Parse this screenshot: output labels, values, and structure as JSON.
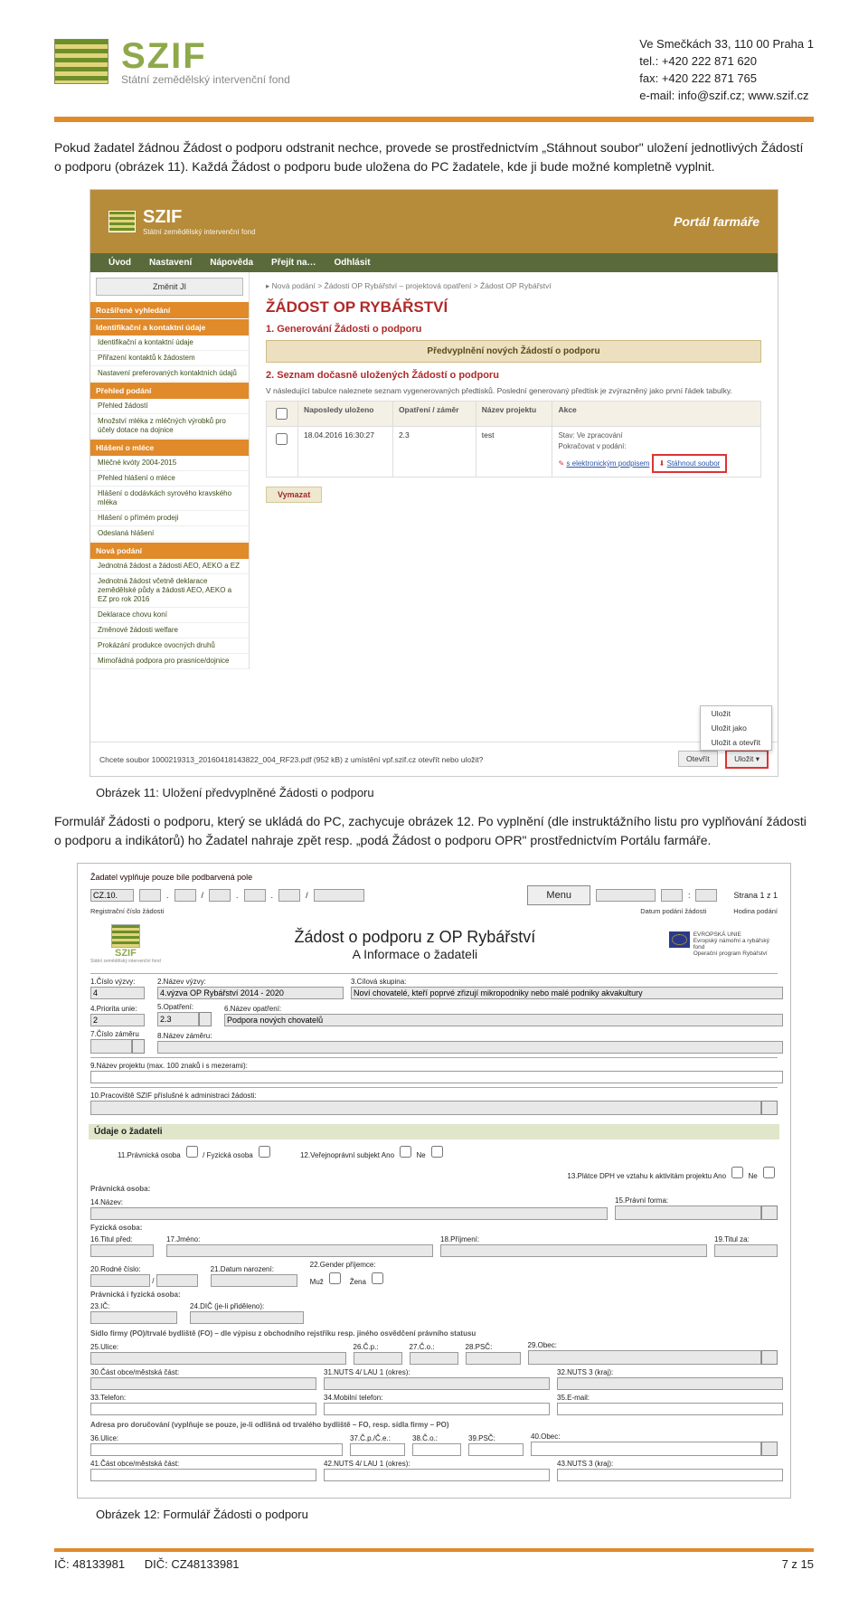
{
  "contact": {
    "line1": "Ve Smečkách 33, 110 00 Praha 1",
    "line2": "tel.: +420 222 871 620",
    "line3": "fax: +420 222 871 765",
    "line4": "e-mail: info@szif.cz; www.szif.cz"
  },
  "logo": {
    "name": "SZIF",
    "sub": "Státní zemědělský intervenční fond"
  },
  "para1": "Pokud žadatel žádnou Žádost o podporu odstranit nechce, provede se prostřednictvím „Stáhnout soubor\" uložení jednotlivých Žádostí o podporu (obrázek 11). Každá Žádost o podporu bude uložena do PC žadatele, kde ji bude možné kompletně vyplnit.",
  "caption11": "Obrázek 11: Uložení předvyplněné Žádosti o podporu",
  "para2": "Formulář Žádosti o podporu, který se ukládá do PC, zachycuje obrázek 12. Po vyplnění (dle instruktážního listu pro vyplňování žádosti o podporu a indikátorů) ho Žadatel nahraje zpět resp. „podá Žádost o podporu OPR\" prostřednictvím Portálu farmáře.",
  "caption12": "Obrázek 12: Formulář Žádosti o podporu",
  "shot1": {
    "portal_title": "Portál farmáře",
    "top_szif": "SZIF",
    "top_sub": "Státní zemědělský intervenční fond",
    "nav": [
      "Úvod",
      "Nastavení",
      "Nápověda",
      "Přejít na…",
      "Odhlásit"
    ],
    "side_btn": "Změnit JI",
    "side_search_hdr": "Rozšířené vyhledání",
    "side_groups": [
      {
        "hdr": "Identifikační a kontaktní údaje",
        "rows": [
          "Identifikační a kontaktní údaje",
          "Přiřazení kontaktů k žádostem",
          "Nastavení preferovaných kontaktních údajů"
        ]
      },
      {
        "hdr": "Přehled podání",
        "rows": [
          "Přehled žádostí",
          "Množství mléka z mléčných výrobků pro účely dotace na dojnice",
          "Mléčné kvóty 2004-2015",
          "Přehled hlášení o mléce",
          "Hlášení o dodávkách syrového kravského mléka",
          "Hlášení o přímém prodeji",
          "Odeslaná hlášení"
        ]
      },
      {
        "hdr": "Hlášení o mléce",
        "rows": []
      },
      {
        "hdr": "Nová podání",
        "rows": [
          "Jednotná žádost a žádosti AEO, AEKO a EZ",
          "Jednotná žádost včetně deklarace zemědělské půdy a žádosti AEO, AEKO a EZ pro rok 2016",
          "Deklarace chovu koní",
          "Změnové žádosti welfare",
          "Prokázání produkce ovocných druhů",
          "Mimořádná podpora pro prasnice/dojnice"
        ]
      }
    ],
    "crumb": "▸ Nová podání > Žádosti OP Rybářství – projektová opatření > Žádost OP Rybářství",
    "h1": "ŽÁDOST OP RYBÁŘSTVÍ",
    "h2a": "1. Generování Žádosti o podporu",
    "btn_predvypl": "Předvyplnění nových Žádostí o podporu",
    "h2b": "2. Seznam dočasně uložených Žádostí o podporu",
    "desc": "V následující tabulce naleznete seznam vygenerovaných předtisků. Poslední generovaný předtisk je zvýrazněný jako první řádek tabulky.",
    "tbl_hdr": [
      "",
      "Naposledy uloženo",
      "Opatření / záměr",
      "Název projektu",
      "Akce"
    ],
    "row_date": "18.04.2016 16:30:27",
    "row_op": "2.3",
    "row_proj": "test",
    "row_status_1": "Stav: Ve zpracování",
    "row_status_2": "Pokračovat v podání:",
    "row_link_sign": "s elektronickým podpisem",
    "row_link_dl": "Stáhnout soubor",
    "vymazat": "Vymazat",
    "footer_text": "Chcete soubor 1000219313_20160418143822_004_RF23.pdf (952 kB) z umístění vpf.szif.cz otevřít nebo uložit?",
    "fbtn1": "Otevřít",
    "fbtn2": "Uložit",
    "fbtn2caret": "▾",
    "fopts": [
      "Uložit",
      "Uložit jako",
      "Uložit a otevřít"
    ]
  },
  "shot2": {
    "instr": "Žadatel vyplňuje pouze bíle podbarvená pole",
    "reg_label": "Registrační číslo žádosti",
    "reg_prefix": "CZ.10.",
    "menu": "Menu",
    "date_hint": "Datum podání žádosti",
    "time_hint": "Hodina podání",
    "page_info": "Strana 1 z 1",
    "title1": "Žádost o podporu z OP Rybářství",
    "title2": "A Informace o žadateli",
    "eu_txt": "EVROPSKÁ UNIE\nEvropský námořní a rybářský fond\nOperační program Rybářství",
    "grid_labels": {
      "l1": "1.Číslo výzvy:",
      "l2": "2.Název výzvy:",
      "l3": "3.Cílová skupina:",
      "v1": "4",
      "v2": "4.výzva OP Rybářství 2014 - 2020",
      "v3": "Noví chovatelé, kteří poprvé zřizují mikropodniky nebo malé podniky akvakultury",
      "l4": "4.Priorita unie:",
      "l5": "5.Opatření:",
      "l6": "6.Název opatření:",
      "v4": "2",
      "v5": "2.3",
      "v6": "Podpora nových chovatelů",
      "l7": "7.Číslo záměru",
      "l8": "8.Název záměru:",
      "l9": "9.Název projektu (max. 100 znaků i s mezerami):",
      "l10": "10.Pracoviště SZIF příslušné k administraci žádosti:"
    },
    "sect_udaje": "Údaje o žadateli",
    "o11": "11.Právnická osoba",
    "o11b": "/  Fyzická osoba",
    "o12": "12.Veřejnoprávní subjekt   Ano",
    "o12n": "Ne",
    "o13": "13.Plátce DPH ve vztahu k aktivitám projektu   Ano",
    "o13n": "Ne",
    "po_hdr": "Právnická osoba:",
    "l14": "14.Název:",
    "l15": "15.Právní forma:",
    "fo_hdr": "Fyzická osoba:",
    "l16": "16.Titul před:",
    "l17": "17.Jméno:",
    "l18": "18.Příjmení:",
    "l19": "19.Titul za:",
    "l20": "20.Rodné číslo:",
    "l21": "21.Datum narození:",
    "l22": "22.Gender příjemce:",
    "g_m": "Muž",
    "g_f": "Žena",
    "pofo_hdr": "Právnická i fyzická osoba:",
    "l23": "23.IČ:",
    "l24": "24.DIČ (je-li přiděleno):",
    "sidlo_hdr": "Sídlo firmy (PO)/trvalé bydliště (FO) – dle výpisu z obchodního rejstříku resp. jiného osvědčení právního statusu",
    "l25": "25.Ulice:",
    "l26": "26.Č.p.:",
    "l27": "27.Č.o.:",
    "l28": "28.PSČ:",
    "l29": "29.Obec:",
    "l30": "30.Část obce/městská část:",
    "l31": "31.NUTS 4/ LAU 1 (okres):",
    "l32": "32.NUTS 3 (kraj):",
    "l33": "33.Telefon:",
    "l34": "34.Mobilní telefon:",
    "l35": "35.E-mail:",
    "doruc_hdr": "Adresa pro doručování (vyplňuje se pouze, je-li odlišná od trvalého bydliště – FO, resp. sídla firmy – PO)",
    "l36": "36.Ulice:",
    "l37": "37.Č.p./Č.e.:",
    "l38": "38.Č.o.:",
    "l39": "39.PSČ:",
    "l40": "40.Obec:",
    "l41": "41.Část obce/městská část:",
    "l42": "42.NUTS 4/ LAU 1 (okres):",
    "l43": "43.NUTS 3 (kraj):"
  },
  "footer": {
    "ic": "IČ: 48133981",
    "dic": "DIČ: CZ48133981",
    "page": "7 z 15"
  }
}
